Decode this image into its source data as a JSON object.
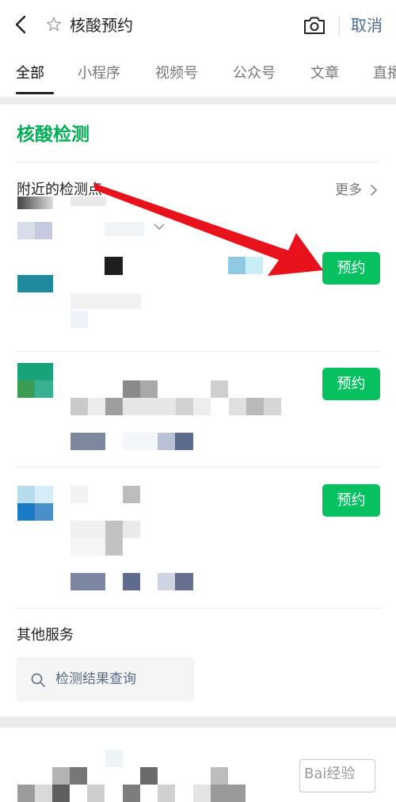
{
  "header": {
    "title": "核酸预约",
    "cancel_label": "取消"
  },
  "tabs": [
    {
      "label": "全部",
      "active": true
    },
    {
      "label": "小程序"
    },
    {
      "label": "视频号"
    },
    {
      "label": "公众号"
    },
    {
      "label": "文章"
    },
    {
      "label": "直播"
    }
  ],
  "section": {
    "title": "核酸检测",
    "nearby_label": "附近的检测点",
    "more_label": "更多"
  },
  "results": [
    {
      "book_label": "预约"
    },
    {
      "book_label": "预约"
    },
    {
      "book_label": "预约"
    }
  ],
  "other_services": {
    "title": "其他服务",
    "query_label": "检测结果查询"
  },
  "watermark": {
    "text": "Bai经验"
  },
  "colors": {
    "accent_green": "#07c160",
    "section_green": "#06ad56",
    "link_blue": "#4a6b93",
    "annotation_red": "#e8121c"
  }
}
